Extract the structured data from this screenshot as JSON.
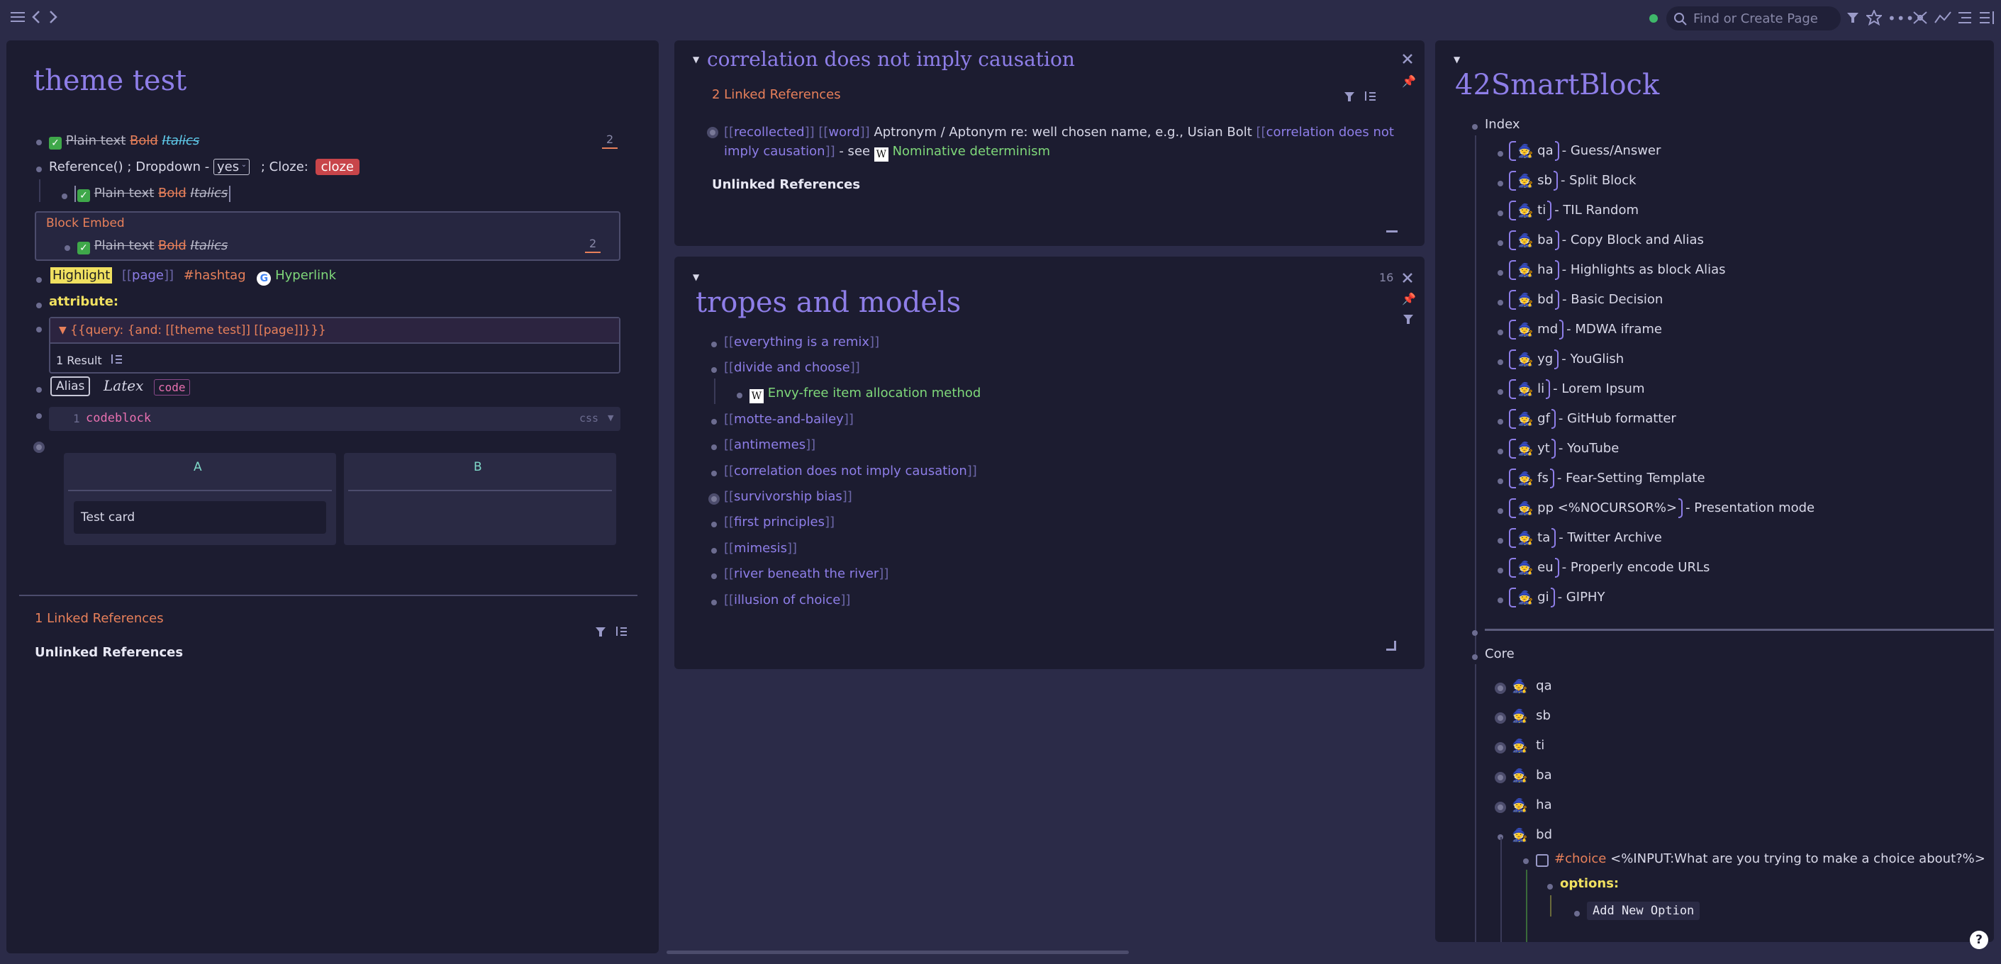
{
  "topbar": {
    "search_placeholder": "Find or Create Page"
  },
  "left_panel": {
    "title": "theme test",
    "row1": {
      "plain": "Plain text",
      "bold": "Bold",
      "italic": "Italics",
      "count": "2"
    },
    "row2": {
      "reference": "Reference()",
      "dropdown_label": "; Dropdown -",
      "dropdown_value": "yes",
      "cloze_label": "; Cloze:",
      "cloze_value": "cloze"
    },
    "row3": {
      "plain": "Plain text",
      "bold": "Bold",
      "italic": "Italics"
    },
    "embed": {
      "label": "Block Embed",
      "plain": "Plain text",
      "bold": "Bold",
      "italic": "Italics",
      "count": "2"
    },
    "row_highlight": {
      "highlight": "Highlight",
      "page": "page",
      "hashtag": "#hashtag",
      "hyperlink": "Hyperlink"
    },
    "attribute": "attribute:",
    "query": {
      "text": "{{query:  {and: [[theme test]] [[page]]}}}",
      "result": "1 Result"
    },
    "row_alias": {
      "alias": "Alias",
      "latex": "Latex",
      "code": "code"
    },
    "codeblock": {
      "line_no": "1",
      "code": "codeblock",
      "lang": "css"
    },
    "kanban": {
      "col_a": "A",
      "col_b": "B",
      "card": "Test card"
    },
    "linked_refs": "1 Linked References",
    "unlinked_refs": "Unlinked References"
  },
  "mid_top_panel": {
    "title": "correlation does not imply causation",
    "linked_refs": "2 Linked References",
    "ref_text_1": "recollected",
    "ref_text_2": "word",
    "ref_plain": "Aptronym / Aptonym re: well chosen name, e.g., Usian Bolt",
    "ref_link_a": "correlation does not",
    "ref_link_b": "imply causation",
    "ref_see": "- see",
    "ref_green": "Nominative determinism",
    "unlinked_refs": "Unlinked References"
  },
  "mid_bottom_panel": {
    "title": "tropes and models",
    "count": "16",
    "items": [
      "everything is a remix",
      "divide and choose",
      "Envy-free item allocation method",
      "motte-and-bailey",
      "antimemes",
      "correlation does not imply causation",
      "survivorship bias",
      "first principles",
      "mimesis",
      "river beneath the river",
      "illusion of choice"
    ]
  },
  "right_panel": {
    "title": "42SmartBlock",
    "index_label": "Index",
    "smartblocks": [
      {
        "key": "qa",
        "desc": "- Guess/Answer"
      },
      {
        "key": "sb",
        "desc": "- Split Block"
      },
      {
        "key": "ti",
        "desc": "- TIL Random"
      },
      {
        "key": "ba",
        "desc": "- Copy Block and Alias"
      },
      {
        "key": "ha",
        "desc": "- Highlights as block Alias"
      },
      {
        "key": "bd",
        "desc": "- Basic Decision"
      },
      {
        "key": "md",
        "desc": "- MDWA iframe"
      },
      {
        "key": "yg",
        "desc": "- YouGlish"
      },
      {
        "key": "li",
        "desc": "- Lorem Ipsum"
      },
      {
        "key": "gf",
        "desc": "- GitHub formatter"
      },
      {
        "key": "yt",
        "desc": "- YouTube"
      },
      {
        "key": "fs",
        "desc": "- Fear-Setting Template"
      },
      {
        "key": "pp <%NOCURSOR%>",
        "desc": "- Presentation mode"
      },
      {
        "key": "ta",
        "desc": "- Twitter Archive"
      },
      {
        "key": "eu",
        "desc": "- Properly encode URLs"
      },
      {
        "key": "gi",
        "desc": "- GIPHY"
      }
    ],
    "core_label": "Core",
    "core_items": [
      "qa",
      "sb",
      "ti",
      "ba",
      "ha",
      "bd"
    ],
    "choice_tag": "#choice",
    "choice_text": "<%INPUT:What are you trying to make a choice about?%>",
    "options_label": "options:",
    "add_option": "Add New Option"
  }
}
